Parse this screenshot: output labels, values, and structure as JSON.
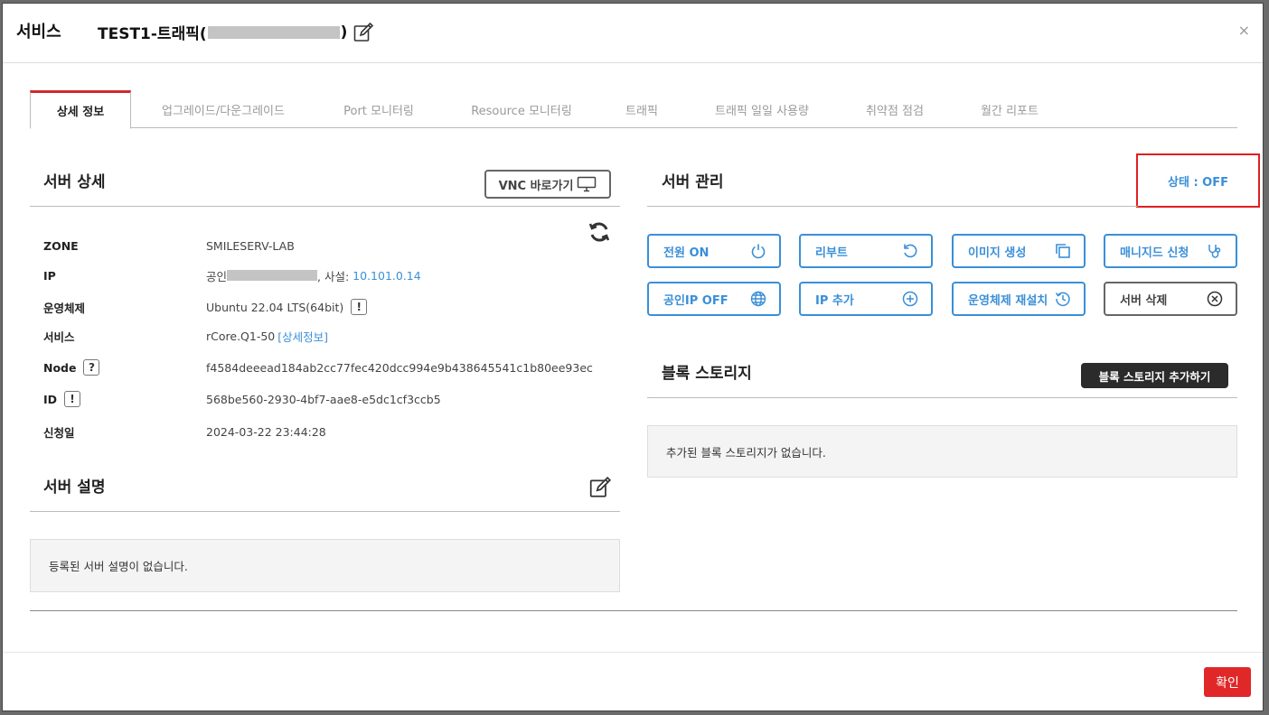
{
  "header": {
    "title": "서비스",
    "server_name_prefix": "TEST1-트래픽(",
    "server_name_suffix": ")",
    "close": "×"
  },
  "tabs": [
    {
      "label": "상세 정보",
      "active": true
    },
    {
      "label": "업그레이드/다운그레이드"
    },
    {
      "label": "Port 모니터링"
    },
    {
      "label": "Resource 모니터링"
    },
    {
      "label": "트래픽"
    },
    {
      "label": "트래픽 일일 사용량"
    },
    {
      "label": "취약점 점검"
    },
    {
      "label": "월간 리포트"
    }
  ],
  "server_detail": {
    "title": "서버 상세",
    "vnc_label": "VNC 바로가기",
    "rows": {
      "zone": {
        "label": "ZONE",
        "value": "SMILESERV-LAB"
      },
      "ip": {
        "label": "IP",
        "public_prefix": "공인",
        "private_prefix": ", 사설: ",
        "private_ip": "10.101.0.14"
      },
      "os": {
        "label": "운영체제",
        "value": "Ubuntu 22.04 LTS(64bit)"
      },
      "service": {
        "label": "서비스",
        "value": "rCore.Q1-50",
        "link": "[상세정보]"
      },
      "node": {
        "label": "Node",
        "value": "f4584deeead184ab2cc77fec420dcc994e9b438645541c1b80ee93ec"
      },
      "id": {
        "label": "ID",
        "value": "568be560-2930-4bf7-aae8-e5dc1cf3ccb5"
      },
      "created": {
        "label": "신청일",
        "value": "2024-03-22 23:44:28"
      }
    },
    "badge_help": "?",
    "badge_warn": "!"
  },
  "server_desc": {
    "title": "서버 설명",
    "empty": "등록된 서버 설명이 없습니다."
  },
  "server_mgmt": {
    "title": "서버 관리",
    "status": "상태 : OFF",
    "buttons": {
      "power_on": "전원 ON",
      "reboot": "리부트",
      "image": "이미지 생성",
      "managed": "매니지드 신청",
      "public_ip_off": "공인IP OFF",
      "ip_add": "IP 추가",
      "reinstall": "운영체제 재설치",
      "delete": "서버 삭제"
    }
  },
  "block_storage": {
    "title": "블록 스토리지",
    "add_label": "블록 스토리지 추가하기",
    "empty": "추가된 블록 스토리지가 없습니다."
  },
  "footer": {
    "confirm": "확인"
  },
  "colors": {
    "accent_blue": "#3a8fd8",
    "tab_active_red": "#d02a2a",
    "confirm_red": "#e02828"
  }
}
